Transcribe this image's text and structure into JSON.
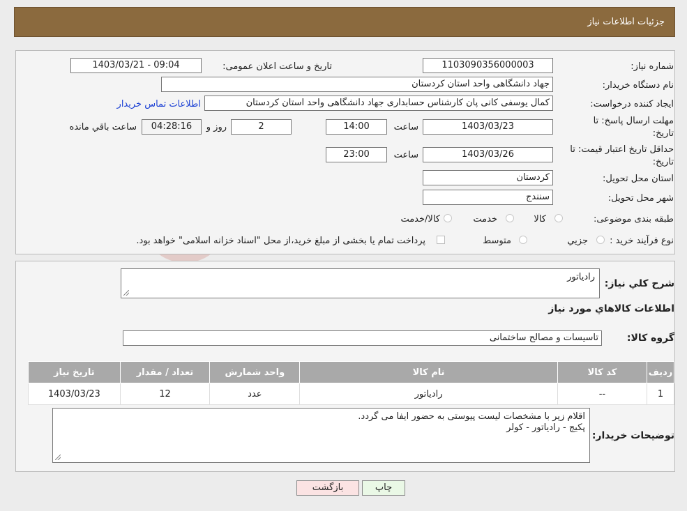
{
  "header": {
    "title": "جزئیات اطلاعات نیاز"
  },
  "form": {
    "need_number_label": "شماره نیاز:",
    "need_number": "1103090356000003",
    "announce_label": "تاریخ و ساعت اعلان عمومی:",
    "announce_value": "1403/03/21 - 09:04",
    "buyer_org_label": "نام دستگاه خریدار:",
    "buyer_org": "جهاد دانشگاهی واحد استان کردستان",
    "creator_label": "ایجاد کننده درخواست:",
    "creator": "کمال یوسفی کانی پان کارشناس حسابداری جهاد دانشگاهی واحد استان کردستان",
    "contact_link": "اطلاعات تماس خریدار",
    "deadline_label_1": "مهلت ارسال پاسخ: تا",
    "deadline_label_2": "تاریخ:",
    "deadline_date": "1403/03/23",
    "time_label": "ساعت",
    "deadline_time": "14:00",
    "days_value": "2",
    "days_label": "روز و",
    "remaining_time": "04:28:16",
    "remaining_label": "ساعت باقي مانده",
    "validity_label_1": "حداقل تاریخ اعتبار قیمت: تا",
    "validity_label_2": "تاریخ:",
    "validity_date": "1403/03/26",
    "validity_time": "23:00",
    "province_label": "استان محل تحویل:",
    "province": "کردستان",
    "city_label": "شهر محل تحویل:",
    "city": "سنندج",
    "category_label": "طبقه بندی موضوعی:",
    "category_options": [
      "کالا",
      "خدمت",
      "کالا/خدمت"
    ],
    "process_label": "نوع فرآیند خرید :",
    "process_options": [
      "جزیي",
      "متوسط"
    ],
    "payment_note": "پرداخت تمام یا بخشی از مبلغ خرید،از محل \"اسناد خزانه اسلامی\" خواهد بود."
  },
  "details": {
    "summary_label": "شرح كلي نياز:",
    "summary": "رادیاتور",
    "goods_info_title": "اطلاعات کالاهاي مورد نياز",
    "goods_group_label": "گروه کالا:",
    "goods_group": "تاسیسات و مصالح ساختمانی",
    "table": {
      "headers": [
        "رديف",
        "کد کالا",
        "نام کالا",
        "واحد شمارش",
        "تعداد / مقدار",
        "تاریخ نیاز"
      ],
      "rows": [
        [
          "1",
          "--",
          "رادیاتور",
          "عدد",
          "12",
          "1403/03/23"
        ]
      ]
    },
    "buyer_notes_label": "توضیحات خریدار:",
    "buyer_notes_line1": "اقلام زیر با مشخصات لیست پیوستی به حضور ایفا می گردد.",
    "buyer_notes_line2": "پکیج - رادیاتور - کولر"
  },
  "buttons": {
    "print": "چاپ",
    "back": "بازگشت"
  }
}
